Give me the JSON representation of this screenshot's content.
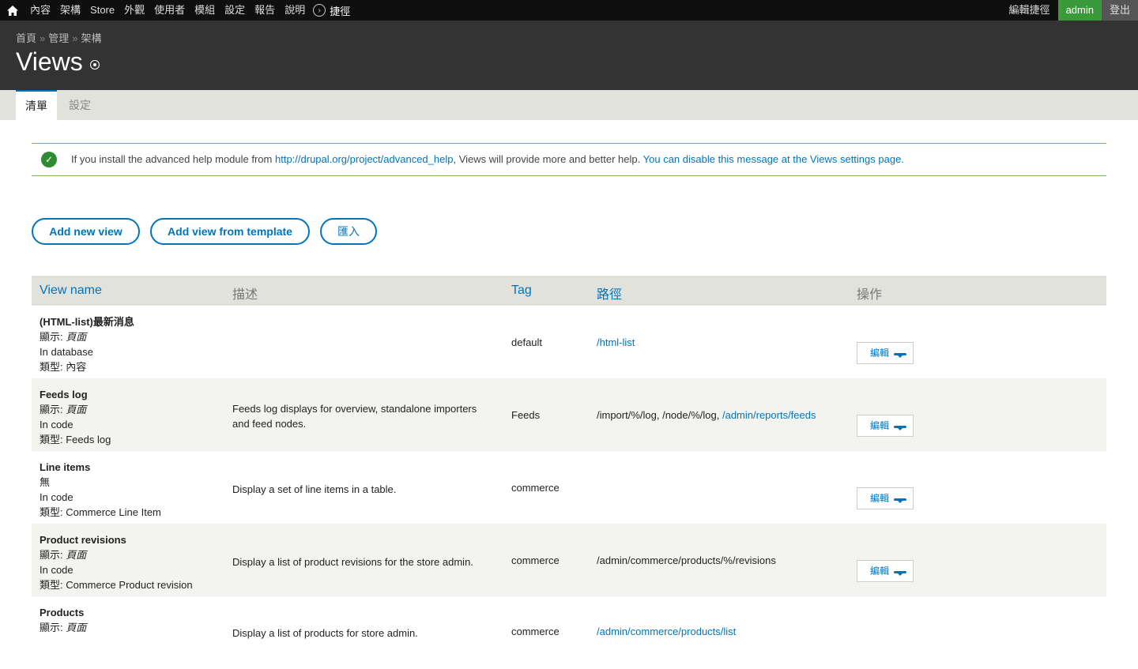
{
  "toolbar": {
    "menu": [
      "內容",
      "架構",
      "Store",
      "外觀",
      "使用者",
      "模組",
      "設定",
      "報告",
      "說明"
    ],
    "shortcuts_label": "捷徑",
    "edit_shortcuts": "編輯捷徑",
    "user": "admin",
    "logout": "登出"
  },
  "header": {
    "breadcrumb": [
      "首頁",
      "管理",
      "架構"
    ],
    "breadcrumb_sep": "»",
    "title": "Views"
  },
  "tabs": [
    {
      "label": "清單",
      "active": true
    },
    {
      "label": "設定",
      "active": false
    }
  ],
  "message": {
    "pre": "If you install the advanced help module from ",
    "link1": "http://drupal.org/project/advanced_help",
    "mid": ", Views will provide more and better help. ",
    "link2": "You can disable this message at the Views settings page."
  },
  "actions": {
    "add_new": "Add new view",
    "add_template": "Add view from template",
    "import": "匯入"
  },
  "table": {
    "headers": {
      "name": "View name",
      "desc": "描述",
      "tag": "Tag",
      "path": "路徑",
      "ops": "操作"
    },
    "op_label": "編輯",
    "rows": [
      {
        "name": "(HTML-list)最新消息",
        "display_prefix": "顯示: ",
        "display": "頁面",
        "storage": "In database",
        "type": "類型: 內容",
        "desc": "",
        "tag": "default",
        "path_plain": "",
        "path_link": "/html-list"
      },
      {
        "name": "Feeds log",
        "display_prefix": "顯示: ",
        "display": "頁面",
        "storage": "In code",
        "type": "類型: Feeds log",
        "desc": "Feeds log displays for overview, standalone importers and feed nodes.",
        "tag": "Feeds",
        "path_plain": "/import/%/log, /node/%/log, ",
        "path_link": "/admin/reports/feeds"
      },
      {
        "name": "Line items",
        "display_prefix": "",
        "display": "無",
        "storage": "In code",
        "type": "類型: Commerce Line Item",
        "desc": "Display a set of line items in a table.",
        "tag": "commerce",
        "path_plain": "",
        "path_link": ""
      },
      {
        "name": "Product revisions",
        "display_prefix": "顯示: ",
        "display": "頁面",
        "storage": "In code",
        "type": "類型: Commerce Product revision",
        "desc": "Display a list of product revisions for the store admin.",
        "tag": "commerce",
        "path_plain": "/admin/commerce/products/%/revisions",
        "path_link": ""
      },
      {
        "name": "Products",
        "display_prefix": "顯示: ",
        "display": "頁面",
        "storage": "",
        "type": "",
        "desc": "Display a list of products for store admin.",
        "tag": "commerce",
        "path_plain": "",
        "path_link": "/admin/commerce/products/list"
      }
    ]
  }
}
